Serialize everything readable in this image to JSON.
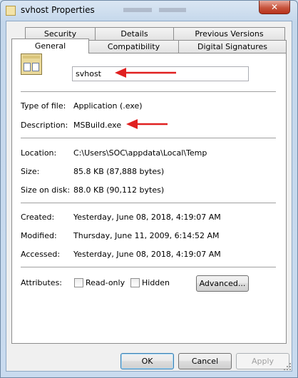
{
  "window": {
    "title": "svhost Properties",
    "close_label": "✕"
  },
  "tabs_back": [
    "Security",
    "Details",
    "Previous Versions"
  ],
  "tabs_front": [
    "General",
    "Compatibility",
    "Digital Signatures"
  ],
  "general": {
    "filename": "svhost",
    "type_label": "Type of file:",
    "type_value": "Application (.exe)",
    "description_label": "Description:",
    "description_value": "MSBuild.exe",
    "location_label": "Location:",
    "location_value": "C:\\Users\\SOC\\appdata\\Local\\Temp",
    "size_label": "Size:",
    "size_value": "85.8 KB (87,888 bytes)",
    "size_on_disk_label": "Size on disk:",
    "size_on_disk_value": "88.0 KB (90,112 bytes)",
    "created_label": "Created:",
    "created_value": "Yesterday, June 08, 2018, 4:19:07 AM",
    "modified_label": "Modified:",
    "modified_value": "Thursday, June 11, 2009, 6:14:52 AM",
    "accessed_label": "Accessed:",
    "accessed_value": "Yesterday, June 08, 2018, 4:19:07 AM",
    "attributes_label": "Attributes:",
    "readonly_label": "Read-only",
    "hidden_label": "Hidden",
    "advanced_label": "Advanced..."
  },
  "buttons": {
    "ok": "OK",
    "cancel": "Cancel",
    "apply": "Apply"
  },
  "colors": {
    "annotation_arrow": "#e02020"
  }
}
